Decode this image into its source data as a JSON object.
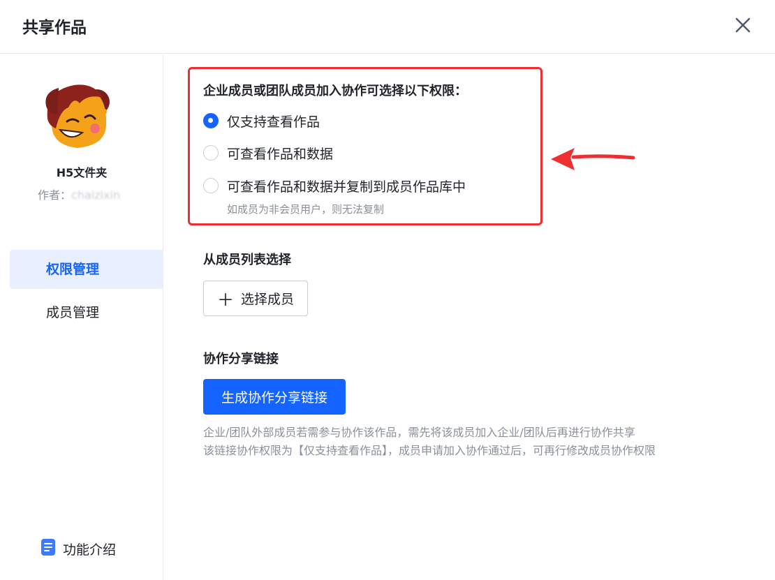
{
  "dialog": {
    "title": "共享作品"
  },
  "sidebar": {
    "work_name": "H5文件夹",
    "author_label": "作者：",
    "author_name": "chaizixin",
    "items": [
      {
        "label": "权限管理",
        "active": true
      },
      {
        "label": "成员管理",
        "active": false
      }
    ],
    "feature_intro": "功能介绍"
  },
  "permissions": {
    "title": "企业成员或团队成员加入协作可选择以下权限：",
    "options": [
      {
        "label": "仅支持查看作品",
        "checked": true
      },
      {
        "label": "可查看作品和数据",
        "checked": false
      },
      {
        "label": "可查看作品和数据并复制到成员作品库中",
        "checked": false
      }
    ],
    "hint": "如成员为非会员用户，则无法复制"
  },
  "member_select": {
    "title": "从成员列表选择",
    "button_label": "选择成员"
  },
  "share_link": {
    "title": "协作分享链接",
    "button_label": "生成协作分享链接",
    "notes": [
      "企业/团队外部成员若需参与协作该作品，需先将该成员加入企业/团队后再进行协作共享",
      "该链接协作权限为【仅支持查看作品】，成员申请加入协作通过后，可再行修改成员协作权限"
    ]
  },
  "colors": {
    "accent": "#1664ff",
    "annotation": "#ee2f2f",
    "nav_active_bg": "#e8efff"
  }
}
